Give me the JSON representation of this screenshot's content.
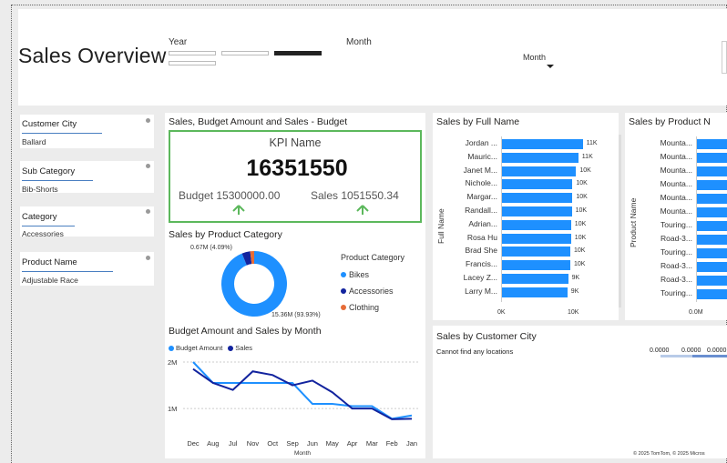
{
  "header": {
    "title": "Sales Overview",
    "year_label": "Year",
    "month_label": "Month",
    "month_dropdown": "Month"
  },
  "filters": [
    {
      "title": "Customer City",
      "value": "Ballard"
    },
    {
      "title": "Sub Category",
      "value": "Bib-Shorts"
    },
    {
      "title": "Category",
      "value": "Accessories"
    },
    {
      "title": "Product Name",
      "value": "Adjustable Race"
    }
  ],
  "kpi": {
    "title": "Sales, Budget Amount and Sales - Budget",
    "name": "KPI Name",
    "value": "16351550",
    "budget": "Budget 15300000.00",
    "sales": "Sales 1051550.34"
  },
  "donut": {
    "title": "Sales by Product Category",
    "legend_title": "Product Category",
    "label_small": "0.67M (4.09%)",
    "label_large": "15.36M (93.93%)",
    "segments": [
      {
        "name": "Bikes",
        "value": 93.93,
        "color": "#1e90ff"
      },
      {
        "name": "Accessories",
        "value": 4.09,
        "color": "#12239e"
      },
      {
        "name": "Clothing",
        "value": 1.98,
        "color": "#e66c37"
      }
    ]
  },
  "full_name_chart": {
    "title": "Sales by Full Name",
    "axis_label": "Full Name",
    "x_ticks": [
      "0K",
      "10K"
    ],
    "rows": [
      {
        "name": "Jordan ...",
        "label": "11K",
        "value": 11.2
      },
      {
        "name": "Mauric...",
        "label": "11K",
        "value": 10.6
      },
      {
        "name": "Janet M...",
        "label": "10K",
        "value": 10.3
      },
      {
        "name": "Nichole...",
        "label": "10K",
        "value": 9.8
      },
      {
        "name": "Margar...",
        "label": "10K",
        "value": 9.8
      },
      {
        "name": "Randall...",
        "label": "10K",
        "value": 9.7
      },
      {
        "name": "Adrian...",
        "label": "10K",
        "value": 9.6
      },
      {
        "name": "Rosa Hu",
        "label": "10K",
        "value": 9.6
      },
      {
        "name": "Brad She",
        "label": "10K",
        "value": 9.5
      },
      {
        "name": "Francis...",
        "label": "10K",
        "value": 9.5
      },
      {
        "name": "Lacey Z...",
        "label": "9K",
        "value": 9.2
      },
      {
        "name": "Larry M...",
        "label": "9K",
        "value": 9.1
      }
    ]
  },
  "product_name_chart": {
    "title": "Sales by Product N",
    "axis_label": "Product Name",
    "x_tick": "0.0M",
    "rows": [
      {
        "name": "Mounta...",
        "value": 1
      },
      {
        "name": "Mounta...",
        "value": 1
      },
      {
        "name": "Mounta...",
        "value": 1
      },
      {
        "name": "Mounta...",
        "value": 1
      },
      {
        "name": "Mounta...",
        "value": 1
      },
      {
        "name": "Mounta...",
        "value": 1
      },
      {
        "name": "Touring...",
        "value": 1
      },
      {
        "name": "Road-3...",
        "value": 1
      },
      {
        "name": "Touring...",
        "value": 1
      },
      {
        "name": "Road-3...",
        "value": 1
      },
      {
        "name": "Road-3...",
        "value": 1
      },
      {
        "name": "Touring...",
        "value": 1
      }
    ]
  },
  "map": {
    "title": "Sales by Customer City",
    "message": "Cannot find any locations",
    "scale": [
      "0.0000",
      "0.0000",
      "0.0000"
    ],
    "footer": "© 2025 TomTom, © 2025 Micros"
  },
  "line_chart": {
    "title": "Budget Amount and Sales by Month",
    "xlabel": "Month",
    "legend": [
      {
        "name": "Budget Amount",
        "color": "#1e90ff"
      },
      {
        "name": "Sales",
        "color": "#12239e"
      }
    ],
    "y_ticks": [
      "2M",
      "1M"
    ]
  },
  "chart_data": {
    "type": "line",
    "title": "Budget Amount and Sales by Month",
    "xlabel": "Month",
    "ylabel": "",
    "ylim": [
      0.65,
      2.0
    ],
    "categories": [
      "Dec",
      "Aug",
      "Jul",
      "Nov",
      "Oct",
      "Sep",
      "Jun",
      "May",
      "Apr",
      "Mar",
      "Feb",
      "Jan"
    ],
    "series": [
      {
        "name": "Budget Amount",
        "values": [
          2.0,
          1.55,
          1.55,
          1.55,
          1.55,
          1.55,
          1.1,
          1.1,
          1.05,
          1.05,
          0.78,
          0.85
        ]
      },
      {
        "name": "Sales",
        "values": [
          1.85,
          1.55,
          1.4,
          1.8,
          1.72,
          1.5,
          1.6,
          1.35,
          1.0,
          1.0,
          0.77,
          0.78
        ]
      }
    ]
  }
}
